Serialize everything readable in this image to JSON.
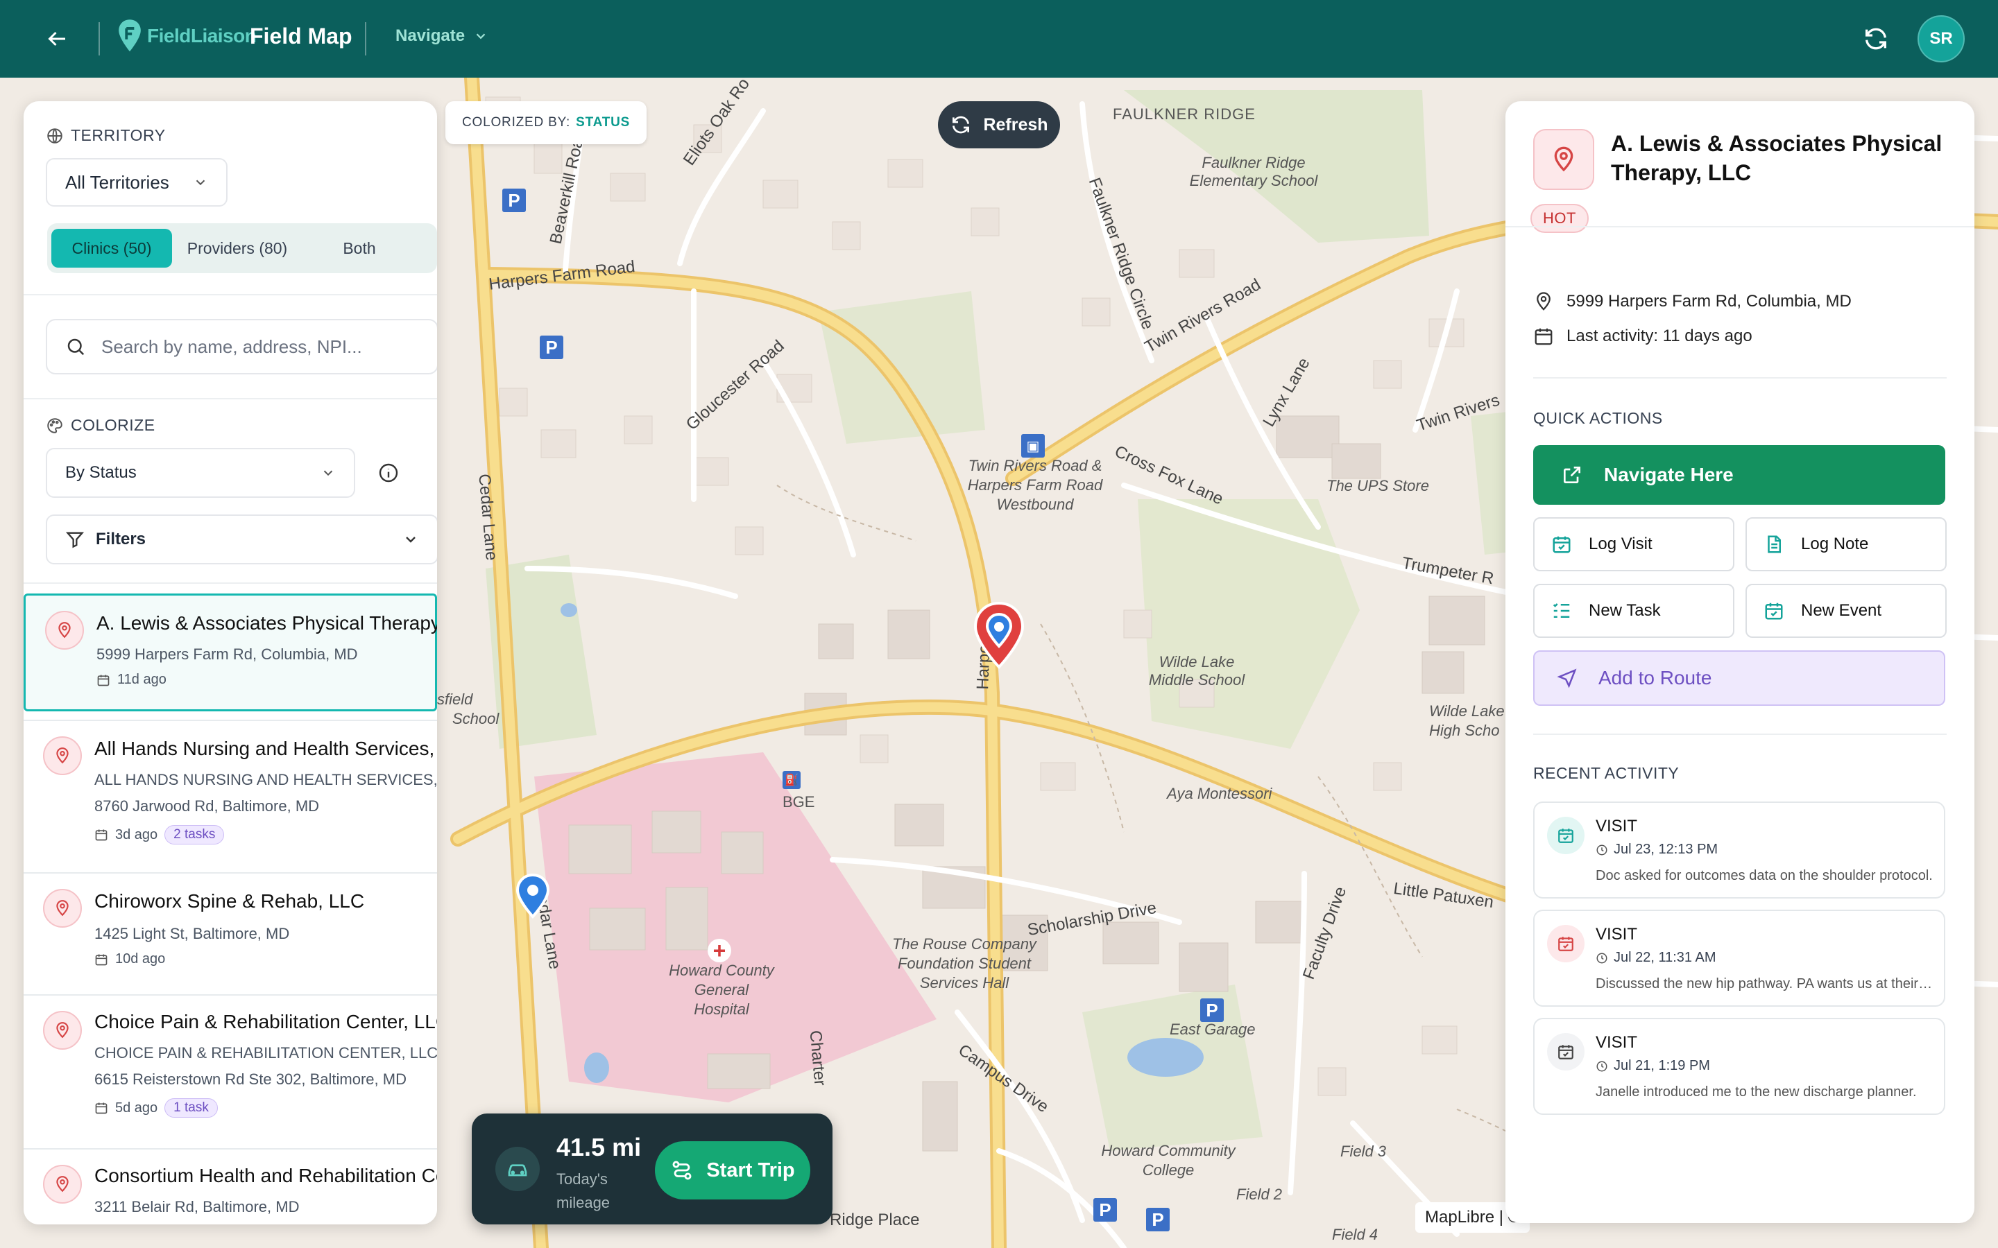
{
  "header": {
    "brand": "FieldLiaison",
    "title": "Field Map",
    "navigate_label": "Navigate",
    "avatar_initials": "SR"
  },
  "left_panel": {
    "territory_label": "TERRITORY",
    "territory_value": "All Territories",
    "segments": [
      "Clinics (50)",
      "Providers (80)",
      "Both"
    ],
    "active_segment": "Clinics (50)",
    "search_placeholder": "Search by name, address, NPI...",
    "colorize_label": "COLORIZE",
    "colorize_value": "By Status",
    "filters_label": "Filters",
    "items": [
      {
        "name": "A. Lewis & Associates Physical Therapy, LLC",
        "sub": "",
        "address": "5999 Harpers Farm Rd, Columbia, MD",
        "ago": "11d ago",
        "tasks": ""
      },
      {
        "name": "All Hands Nursing and Health Services, LLC",
        "sub": "ALL HANDS NURSING AND HEALTH SERVICES, LLC",
        "address": "8760 Jarwood Rd, Baltimore, MD",
        "ago": "3d ago",
        "tasks": "2 tasks"
      },
      {
        "name": "Chiroworx Spine & Rehab, LLC",
        "sub": "",
        "address": "1425 Light St, Baltimore, MD",
        "ago": "10d ago",
        "tasks": ""
      },
      {
        "name": "Choice Pain & Rehabilitation Center, LLC",
        "sub": "CHOICE PAIN & REHABILITATION CENTER, LLC",
        "address": "6615 Reisterstown Rd Ste 302, Baltimore, MD",
        "ago": "5d ago",
        "tasks": "1 task"
      },
      {
        "name": "Consortium Health and Rehabilitation Center",
        "sub": "",
        "address": "3211 Belair Rd, Baltimore, MD",
        "ago": "",
        "tasks": ""
      }
    ]
  },
  "map": {
    "colorized_by_label": "COLORIZED BY:",
    "colorized_by_value": "STATUS",
    "refresh_label": "Refresh",
    "attribution": "MapLibre | ©",
    "labels": {
      "faulkner_ridge": "FAULKNER RIDGE",
      "faulkner_school": "Faulkner Ridge Elementary School",
      "harpers_farm_road": "Harpers Farm Road",
      "gloucester_road": "Gloucester Road",
      "faulkner_ridge_circle": "Faulkner Ridge Circle",
      "twin_rivers_road": "Twin Rivers Road",
      "twin_rivers_right": "Twin Rivers",
      "lynx_lane": "Lynx Lane",
      "cross_fox_lane": "Cross Fox Lane",
      "ups_store": "The UPS Store",
      "trumpeter": "Trumpeter R",
      "bus_stop": "Twin Rivers Road & Harpers Farm Road Westbound",
      "wilde_lake_ms": "Wilde Lake Middle School",
      "wilde_lake_hs": "Wilde Lake High Scho",
      "aya_montessori": "Aya Montessori",
      "bge": "BGE",
      "howard_hospital": "Howard County General Hospital",
      "scholarship_drive": "Scholarship Drive",
      "rouse": "The Rouse Company Foundation Student Services Hall",
      "faculty_drive": "Faculty Drive",
      "little_patuxent": "Little Patuxen",
      "east_garage": "East Garage",
      "campus_drive": "Campus Drive",
      "howard_college": "Howard Community College",
      "field3": "Field 3",
      "field2": "Field 2",
      "field4": "Field 4",
      "cedar_lane": "Cedar Lane",
      "cedar_lane_2": "Cedar Lane",
      "harpers_rd_v": "Harpers",
      "beaverkill": "Beaverkill Roa",
      "eliots_oak": "Eliots Oak Ro",
      "ridge_place": "Ridge Place",
      "charter": "Charter",
      "fsfield": "sfield",
      "school": "School"
    }
  },
  "trip": {
    "miles": "41.5 mi",
    "sub": "Today's mileage",
    "start_label": "Start Trip"
  },
  "detail": {
    "title": "A. Lewis & Associates Physical Therapy, LLC",
    "status": "HOT",
    "address": "5999 Harpers Farm Rd, Columbia, MD",
    "last_activity": "Last activity: 11 days ago",
    "quick_actions_label": "QUICK ACTIONS",
    "navigate_label": "Navigate Here",
    "actions": [
      "Log Visit",
      "Log Note",
      "New Task",
      "New Event"
    ],
    "route_label": "Add to Route",
    "recent_label": "RECENT ACTIVITY",
    "activities": [
      {
        "type": "VISIT",
        "time": "Jul 23, 12:13 PM",
        "desc": "Doc asked for outcomes data on the shoulder protocol."
      },
      {
        "type": "VISIT",
        "time": "Jul 22, 11:31 AM",
        "desc": "Discussed the new hip pathway. PA wants us at their next meeting."
      },
      {
        "type": "VISIT",
        "time": "Jul 21, 1:19 PM",
        "desc": "Janelle introduced me to the new discharge planner."
      }
    ]
  },
  "colors": {
    "header": "#0b5f5c",
    "accent": "#14b8b0",
    "hot": "#c53030",
    "navigate": "#14915f",
    "route": "#6d4fc2"
  }
}
